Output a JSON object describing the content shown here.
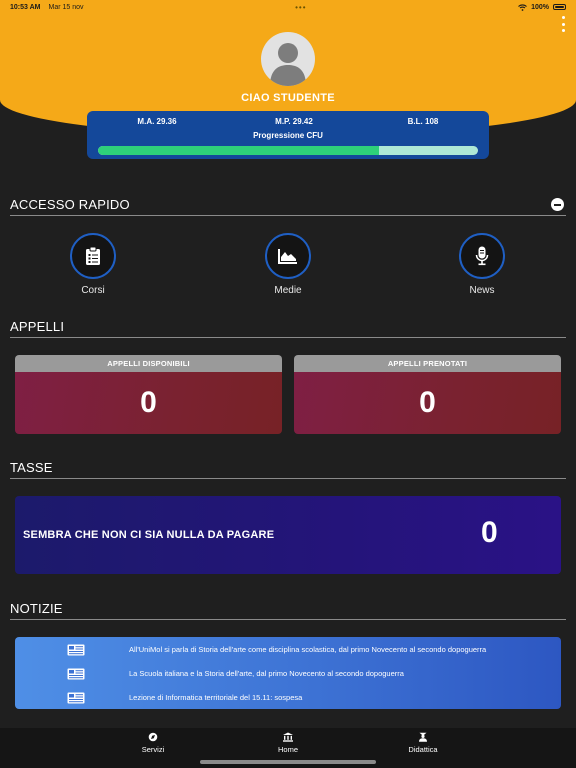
{
  "status_bar": {
    "time": "10:53 AM",
    "date": "Mar 15 nov",
    "battery": "100%"
  },
  "header": {
    "greeting": "CIAO STUDENTE",
    "stats": {
      "ma": "M.A. 29.36",
      "mp": "M.P. 29.42",
      "bl": "B.L. 108"
    },
    "progress_title": "Progressione CFU",
    "progress_fraction": 0.74
  },
  "quick_access": {
    "title": "ACCESSO RAPIDO",
    "items": [
      {
        "label": "Corsi",
        "icon": "clipboard-icon"
      },
      {
        "label": "Medie",
        "icon": "area-chart-icon"
      },
      {
        "label": "News",
        "icon": "microphone-icon"
      }
    ]
  },
  "appelli": {
    "title": "APPELLI",
    "available": {
      "label": "APPELLI DISPONIBILI",
      "count": "0"
    },
    "booked": {
      "label": "APPELLI PRENOTATI",
      "count": "0"
    }
  },
  "tasse": {
    "title": "TASSE",
    "message": "SEMBRA CHE NON CI SIA NULLA DA PAGARE",
    "count": "0"
  },
  "notizie": {
    "title": "NOTIZIE",
    "items": [
      "All'UniMol si parla di Storia dell'arte come disciplina scolastica, dal primo Novecento al secondo dopoguerra",
      "La Scuola italiana e la Storia dell'arte, dal primo Novecento al secondo dopoguerra",
      "Lezione di Informatica territoriale del 15.11: sospesa"
    ]
  },
  "nav": {
    "items": [
      {
        "label": "Servizi",
        "icon": "compass-icon"
      },
      {
        "label": "Home",
        "icon": "bank-icon"
      },
      {
        "label": "Didattica",
        "icon": "graduation-icon"
      }
    ]
  },
  "colors": {
    "header_bg": "#f5a918",
    "cfu_card_bg": "#14489a",
    "progress_fill": "#2ed07a",
    "progress_track": "#aee8d6",
    "appelli_body": "#7a2230",
    "tasse_bg": "#24147a",
    "news_bg": "#3d72d4"
  }
}
